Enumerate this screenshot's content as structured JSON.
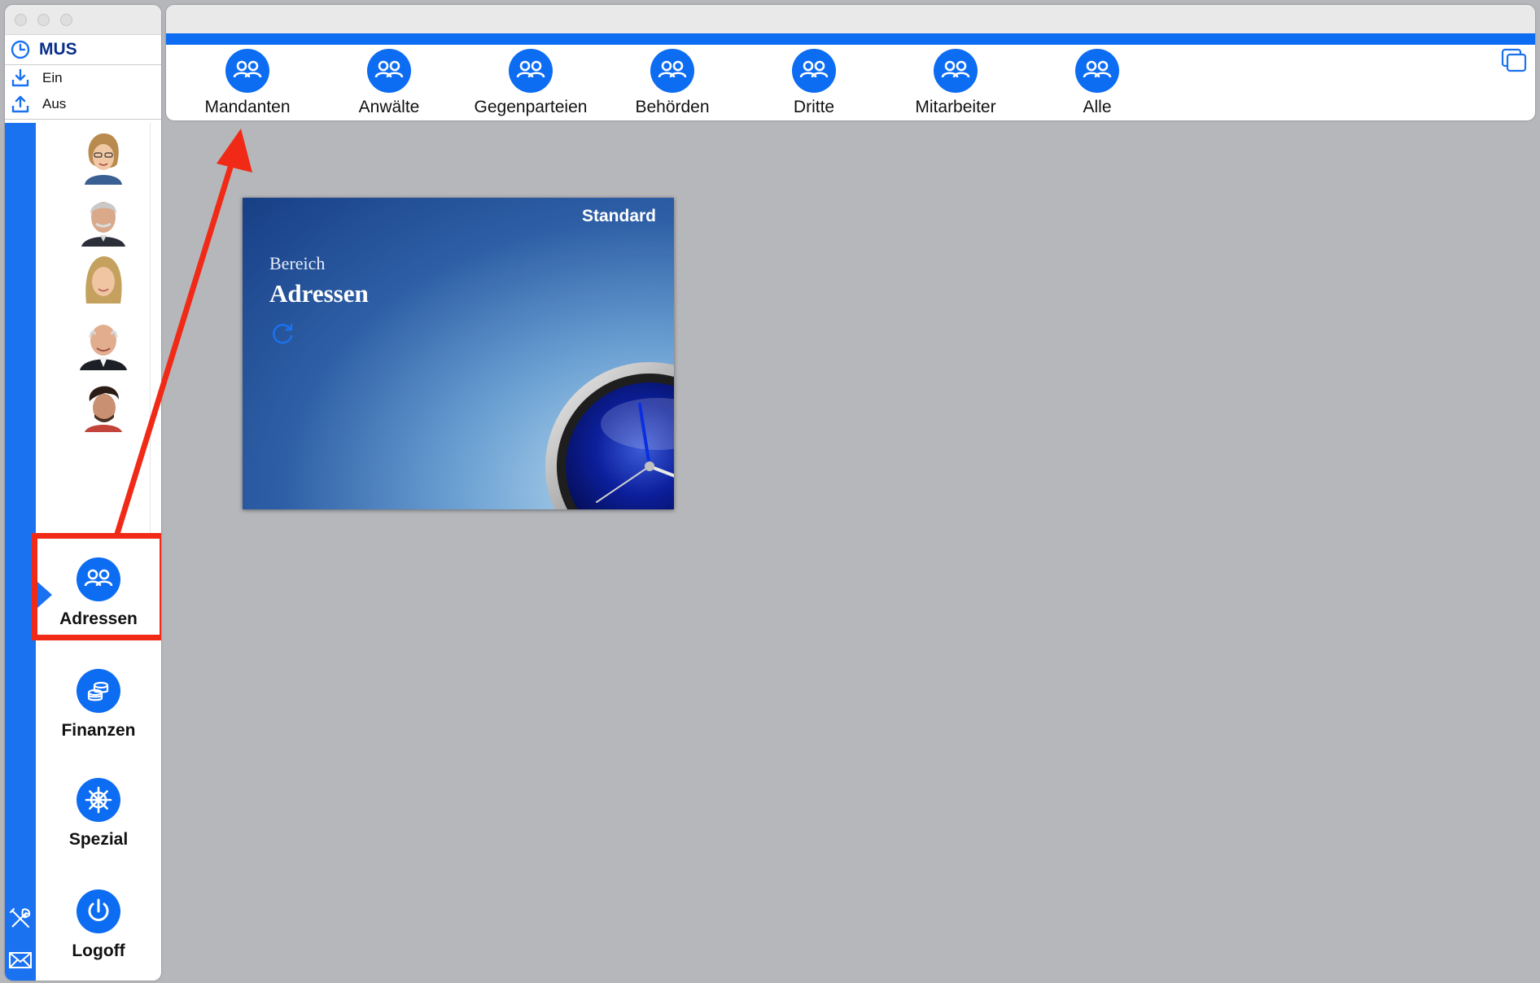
{
  "sidebar": {
    "user": {
      "name": "MUS",
      "icon": "clock-icon"
    },
    "io": [
      {
        "label": "Ein",
        "icon": "download-icon"
      },
      {
        "label": "Aus",
        "icon": "upload-icon"
      }
    ],
    "nav": [
      {
        "label": "Adressen",
        "icon": "people-icon",
        "active": true
      },
      {
        "label": "Finanzen",
        "icon": "coins-icon"
      },
      {
        "label": "Spezial",
        "icon": "ship-wheel-icon"
      },
      {
        "label": "Logoff",
        "icon": "power-icon"
      }
    ],
    "tools": [
      "wrench-screwdriver-icon",
      "mail-icon"
    ]
  },
  "toolbar": {
    "items": [
      {
        "label": "Mandanten",
        "icon": "people-icon"
      },
      {
        "label": "Anwälte",
        "icon": "people-icon"
      },
      {
        "label": "Gegenparteien",
        "icon": "people-icon"
      },
      {
        "label": "Behörden",
        "icon": "people-icon"
      },
      {
        "label": "Dritte",
        "icon": "people-icon"
      },
      {
        "label": "Mitarbeiter",
        "icon": "people-icon"
      },
      {
        "label": "Alle",
        "icon": "people-icon"
      }
    ],
    "windows_icon": "windows-icon"
  },
  "card": {
    "tag": "Standard",
    "subtitle": "Bereich",
    "title": "Adressen",
    "refresh_icon": "refresh-icon"
  },
  "colors": {
    "accent": "#0c6cf2",
    "sidebar_strip": "#1b72f0",
    "highlight": "#f02a16",
    "background": "#b6b7bb"
  }
}
